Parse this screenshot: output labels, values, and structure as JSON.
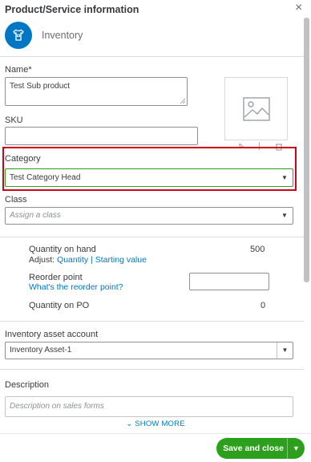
{
  "header": {
    "title": "Product/Service information",
    "close": "×"
  },
  "type": {
    "label": "Inventory"
  },
  "name": {
    "label": "Name*",
    "value": "Test Sub product"
  },
  "sku": {
    "label": "SKU",
    "value": ""
  },
  "category": {
    "label": "Category",
    "value": "Test Category Head"
  },
  "class": {
    "label": "Class",
    "placeholder": "Assign a class"
  },
  "quantity": {
    "on_hand_label": "Quantity on hand",
    "on_hand_value": "500",
    "adjust_label": "Adjust:",
    "adjust_quantity": "Quantity",
    "adjust_sep": "|",
    "adjust_starting": "Starting value"
  },
  "reorder": {
    "label": "Reorder point",
    "help_link": "What's the reorder point?",
    "value": ""
  },
  "on_po": {
    "label": "Quantity on PO",
    "value": "0"
  },
  "asset_account": {
    "label": "Inventory asset account",
    "value": "Inventory Asset-1"
  },
  "description": {
    "label": "Description",
    "placeholder": "Description on sales forms"
  },
  "show_more": {
    "label": "SHOW MORE"
  },
  "footer": {
    "save_label": "Save and close"
  },
  "colors": {
    "brand_blue": "#0077c5",
    "save_green": "#2ca01c",
    "highlight_red": "#d0021b"
  }
}
